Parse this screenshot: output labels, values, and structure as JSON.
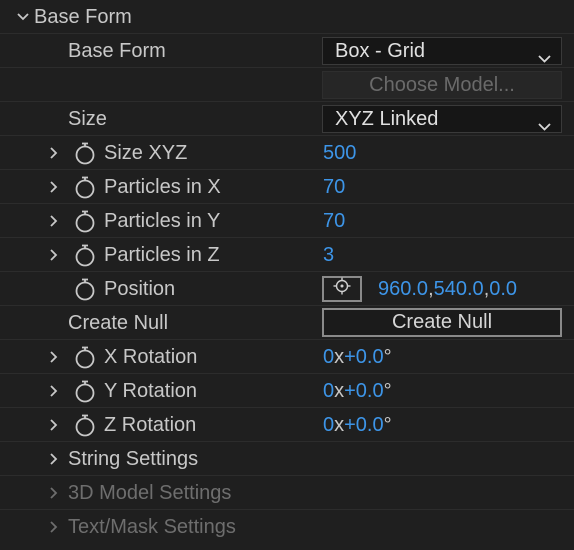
{
  "section": {
    "title": "Base Form"
  },
  "base_form": {
    "label": "Base Form",
    "selected": "Box - Grid",
    "choose_model_label": "Choose Model..."
  },
  "size": {
    "label": "Size",
    "selected": "XYZ Linked"
  },
  "size_xyz": {
    "label": "Size XYZ",
    "value": "500"
  },
  "particles_x": {
    "label": "Particles in X",
    "value": "70"
  },
  "particles_y": {
    "label": "Particles in Y",
    "value": "70"
  },
  "particles_z": {
    "label": "Particles in Z",
    "value": "3"
  },
  "position": {
    "label": "Position",
    "x": "960.0",
    "y": "540.0",
    "z": "0.0",
    "separator": ","
  },
  "create_null": {
    "label": "Create Null",
    "button_label": "Create Null"
  },
  "x_rotation": {
    "label": "X Rotation",
    "revolutions": "0",
    "x_sign": "x",
    "degrees": "+0.0",
    "degree_symbol": "°"
  },
  "y_rotation": {
    "label": "Y Rotation",
    "revolutions": "0",
    "x_sign": "x",
    "degrees": "+0.0",
    "degree_symbol": "°"
  },
  "z_rotation": {
    "label": "Z Rotation",
    "revolutions": "0",
    "x_sign": "x",
    "degrees": "+0.0",
    "degree_symbol": "°"
  },
  "string_settings": {
    "label": "String Settings"
  },
  "model_3d_settings": {
    "label": "3D Model Settings"
  },
  "text_mask_settings": {
    "label": "Text/Mask Settings"
  },
  "colors": {
    "background": "#1f1f1f",
    "value_blue": "#3d95e8",
    "label_text": "#c8c8c8",
    "disabled_text": "#6e6e6e"
  },
  "icons": {
    "twirl_open": "chevron-down-icon",
    "twirl_closed": "chevron-right-icon",
    "stopwatch": "stopwatch-icon",
    "dropdown": "chevron-down-icon",
    "target": "crosshair-icon"
  }
}
